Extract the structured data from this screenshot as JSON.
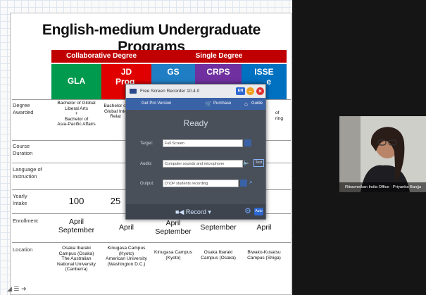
{
  "slide": {
    "title": "English-medium Undergraduate Programs",
    "groups": [
      {
        "label": "Collaborative Degree",
        "color": "#c00000"
      },
      {
        "label": "Single Degree",
        "color": "#c00000"
      }
    ],
    "columns": [
      {
        "code": "GLA",
        "sub": "",
        "color": "#009a4e"
      },
      {
        "code": "JD",
        "sub": "Prog",
        "color": "#e00000"
      },
      {
        "code": "GS",
        "sub": "",
        "color": "#1f7ec4"
      },
      {
        "code": "CRPS",
        "sub": "",
        "color": "#7030a0"
      },
      {
        "code": "ISSE",
        "sub": "e",
        "color": "#0070c0"
      }
    ],
    "row_labels": {
      "degree": "Degree\nAwarded",
      "duration": "Course\nDuration",
      "language": "Language of\nInstruction",
      "intake": "Yearly\nIntake",
      "enrollment": "Enrollment",
      "location": "Location"
    },
    "degree": {
      "gla": "Bachelor of Global\nLiberal Arts\n+\nBachelor of\nAsia-Pacific Affairs",
      "jd": "Bachelor of\nGlobal Inte\nRelat",
      "isse": "of\nring"
    },
    "intake": {
      "gla": "100",
      "jd": "25"
    },
    "enrollment": {
      "gla": "April\nSeptember",
      "jd": "April",
      "gs": "April\nSeptember",
      "crps": "September",
      "isse": "April"
    },
    "location": {
      "gla": "Osaka Ibaraki\nCampus (Osaka)\nThe Australian\nNational University\n(Canberra)",
      "jd": "Kinugasa Campus\n(Kyoto)\nAmerican University\n(Washington D.C.)",
      "gs": "Kinugasa Campus\n(Kyoto)",
      "crps": "Osaka Ibaraki\nCampus (Osaka)",
      "isse": "Biwako-Kusatsu\nCampus (Shiga)"
    }
  },
  "recorder": {
    "title": "Free Screen Recorder 10.4.0",
    "lang": "EN",
    "get_pro": "Get Pro Version",
    "purchase": "Purchase",
    "guide": "Guide",
    "status": "Ready",
    "target_label": "Target:",
    "target_value": "Full Screen",
    "audio_label": "Audio:",
    "audio_value": "Computer sounds and microphone",
    "test_label": "Test",
    "output_label": "Output:",
    "output_value": "D:\\DP students recording",
    "record_label": "Record",
    "auto_label": "Auto"
  },
  "webcam": {
    "name": "Ritsumeikan India Office · Priyanka Banjja"
  }
}
